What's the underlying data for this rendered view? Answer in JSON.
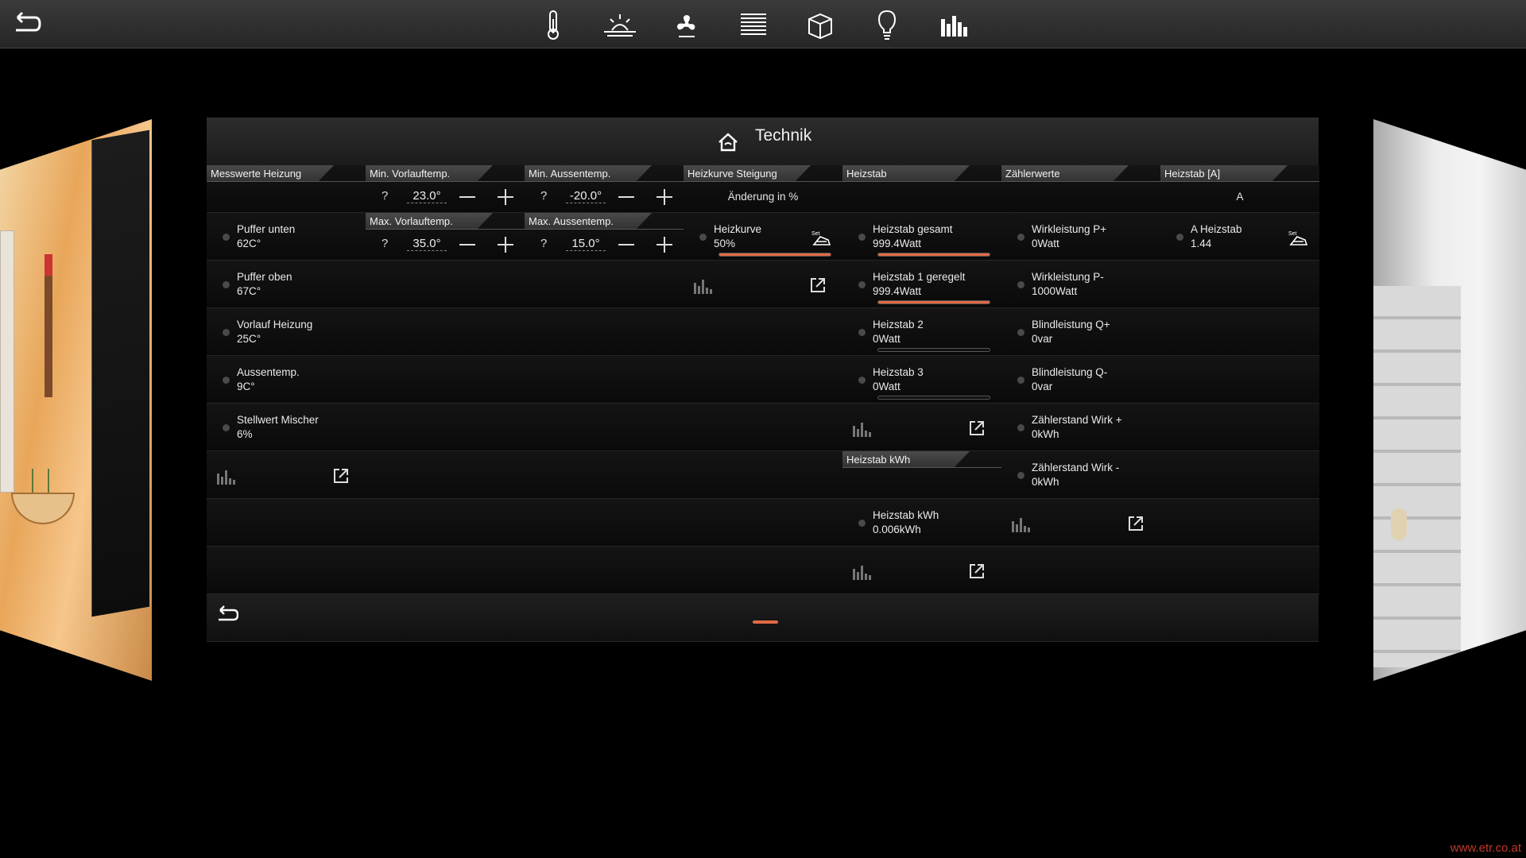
{
  "nav": {
    "icons": [
      "back-arrow-icon",
      "thermometer-icon",
      "sunrise-icon",
      "fan-icon",
      "blinds-icon",
      "box-icon",
      "bulb-icon",
      "bar-chart-icon"
    ]
  },
  "page": {
    "title": "Technik"
  },
  "columns": {
    "messwerte": {
      "header": "Messwerte Heizung",
      "items": [
        {
          "label": "Puffer unten",
          "value": "62C°"
        },
        {
          "label": "Puffer oben",
          "value": "67C°"
        },
        {
          "label": "Vorlauf Heizung",
          "value": "25C°"
        },
        {
          "label": "Aussentemp.",
          "value": "9C°"
        },
        {
          "label": "Stellwert Mischer",
          "value": "6%"
        }
      ]
    },
    "min_vorlauf": {
      "header": "Min. Vorlauftemp.",
      "q": "?",
      "value": "23.0°"
    },
    "max_vorlauf": {
      "header": "Max. Vorlauftemp.",
      "q": "?",
      "value": "35.0°"
    },
    "min_aussen": {
      "header": "Min. Aussentemp.",
      "q": "?",
      "value": "-20.0°"
    },
    "max_aussen": {
      "header": "Max. Aussentemp.",
      "q": "?",
      "value": "15.0°"
    },
    "heizkurve": {
      "header": "Heizkurve Steigung",
      "subtitle": "Änderung in %",
      "label": "Heizkurve",
      "value": "50%",
      "level": 1.0
    },
    "heizstab": {
      "header": "Heizstab",
      "items": [
        {
          "label": "Heizstab gesamt",
          "value": "999.4Watt",
          "level": 1.0
        },
        {
          "label": "Heizstab 1 geregelt",
          "value": "999.4Watt",
          "level": 1.0
        },
        {
          "label": "Heizstab 2",
          "value": "0Watt",
          "level": 0
        },
        {
          "label": "Heizstab 3",
          "value": "0Watt",
          "level": 0
        }
      ]
    },
    "heizstab_kwh": {
      "header": "Heizstab kWh",
      "label": "Heizstab kWh",
      "value": "0.006kWh"
    },
    "zaehlerwerte": {
      "header": "Zählerwerte",
      "items": [
        {
          "label": "Wirkleistung P+",
          "value": "0Watt"
        },
        {
          "label": "Wirkleistung P-",
          "value": "1000Watt"
        },
        {
          "label": "Blindleistung Q+",
          "value": "0var"
        },
        {
          "label": "Blindleistung Q-",
          "value": "0var"
        },
        {
          "label": "Zählerstand Wirk +",
          "value": "0kWh"
        },
        {
          "label": "Zählerstand Wirk -",
          "value": "0kWh"
        }
      ]
    },
    "heizstab_a": {
      "header": "Heizstab [A]",
      "unit": "A",
      "label": "A Heizstab",
      "value": "1.44"
    }
  },
  "watermark": "www.etr.co.at",
  "colors": {
    "accent": "#e06a44",
    "background": "#000000"
  }
}
